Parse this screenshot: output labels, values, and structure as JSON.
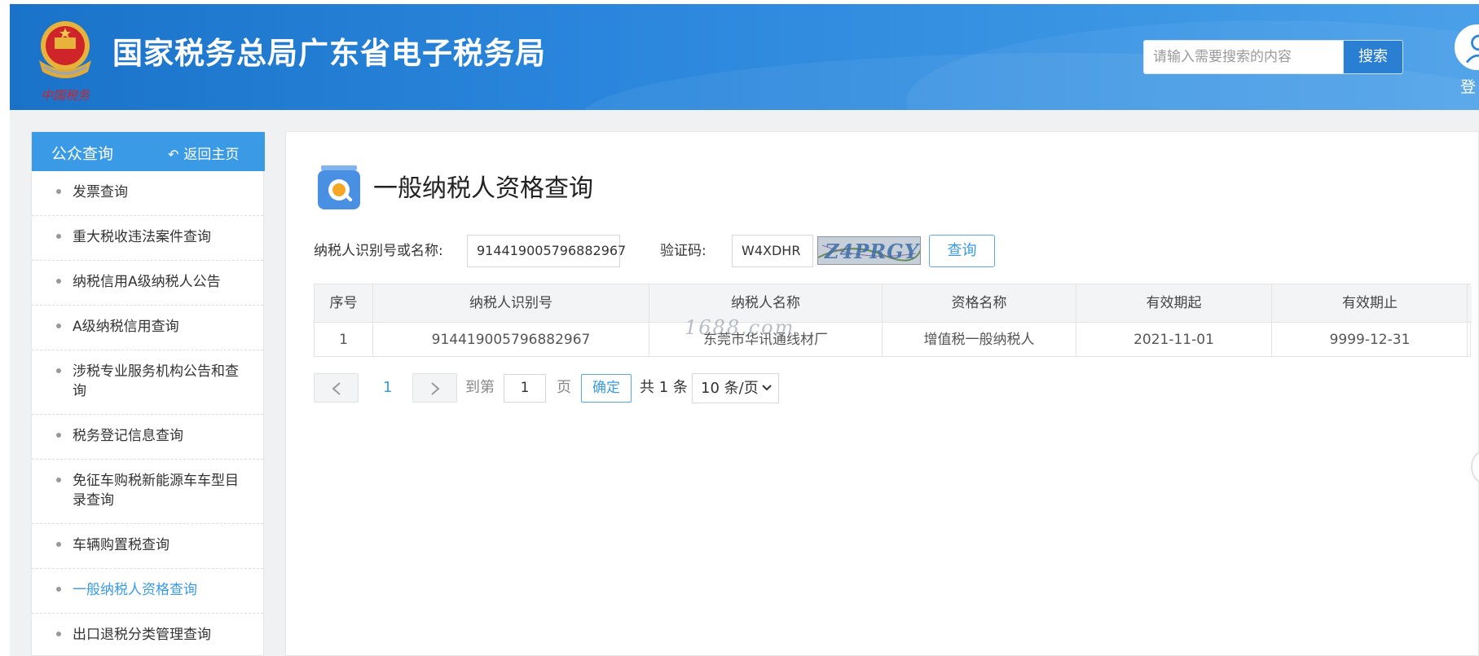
{
  "header": {
    "site_title": "国家税务总局广东省电子税务局",
    "emblem_caption": "中国税务",
    "search_placeholder": "请输入需要搜索的内容",
    "search_button": "搜索",
    "login_label": "登"
  },
  "sidebar": {
    "title": "公众查询",
    "back_label": "返回主页",
    "items": [
      {
        "label": "发票查询"
      },
      {
        "label": "重大税收违法案件查询"
      },
      {
        "label": "纳税信用A级纳税人公告"
      },
      {
        "label": "A级纳税信用查询"
      },
      {
        "label": "涉税专业服务机构公告和查询"
      },
      {
        "label": "税务登记信息查询"
      },
      {
        "label": "免征车购税新能源车车型目录查询"
      },
      {
        "label": "车辆购置税查询"
      },
      {
        "label": "一般纳税人资格查询",
        "active": true
      },
      {
        "label": "出口退税分类管理查询"
      }
    ]
  },
  "main": {
    "page_title": "一般纳税人资格查询",
    "form": {
      "taxpayer_label": "纳税人识别号或名称:",
      "taxpayer_value": "914419005796882967",
      "captcha_label": "验证码:",
      "captcha_value": "W4XDHR",
      "captcha_image_text": "Z4PRGY",
      "query_button": "查询"
    },
    "table": {
      "columns": [
        "序号",
        "纳税人识别号",
        "纳税人名称",
        "资格名称",
        "有效期起",
        "有效期止"
      ],
      "rows": [
        [
          "1",
          "914419005796882967",
          "东莞市华讯通线材厂",
          "增值税一般纳税人",
          "2021-11-01",
          "9999-12-31"
        ]
      ]
    },
    "watermark": "1688.com",
    "pager": {
      "current_page": "1",
      "goto_label": "到第",
      "goto_value": "1",
      "page_unit": "页",
      "confirm_button": "确定",
      "total_text": "共 1 条",
      "per_page": "10 条/页"
    }
  },
  "colors": {
    "header_blue": "#2a86dc",
    "accent": "#3a9ae6",
    "emblem_red": "#d0242b",
    "emblem_gold": "#e8b33a"
  }
}
